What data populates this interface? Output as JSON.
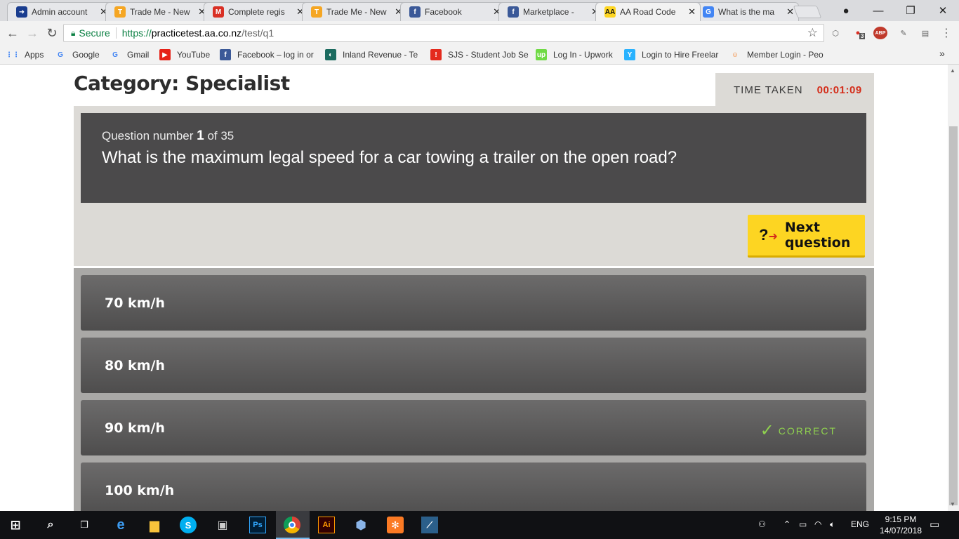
{
  "browser": {
    "tabs": [
      {
        "title": "Admin account",
        "icon": "arrow-circle-icon",
        "color": "#1a3d8f"
      },
      {
        "title": "Trade Me - New",
        "icon": "trademe-icon",
        "color": "#f5a623"
      },
      {
        "title": "Complete regis",
        "icon": "gmail-icon",
        "color": "#d93025"
      },
      {
        "title": "Trade Me - New",
        "icon": "trademe-icon",
        "color": "#f5a623"
      },
      {
        "title": "Facebook",
        "icon": "facebook-icon",
        "color": "#3b5998"
      },
      {
        "title": "Marketplace - ",
        "icon": "facebook-icon",
        "color": "#3b5998"
      },
      {
        "title": "AA Road Code",
        "icon": "aa-icon",
        "color": "#fdd522",
        "active": true
      },
      {
        "title": "What is the ma",
        "icon": "google-icon",
        "color": "#4285f4"
      }
    ],
    "close_glyph": "✕",
    "secure_label": "Secure",
    "url": {
      "proto": "https://",
      "host": "practicetest.aa.co.nz",
      "path": "/test/q1"
    },
    "extension_badge": "3",
    "abp_label": "ABP",
    "bookmarks": [
      {
        "label": "Apps",
        "icon": "apps-grid-icon",
        "color": "#4285f4"
      },
      {
        "label": "Google",
        "icon": "google-icon",
        "color": "#4285f4"
      },
      {
        "label": "Gmail",
        "icon": "google-icon",
        "color": "#4285f4"
      },
      {
        "label": "YouTube",
        "icon": "youtube-icon",
        "color": "#e62117"
      },
      {
        "label": "Facebook – log in or",
        "icon": "facebook-icon",
        "color": "#3b5998"
      },
      {
        "label": "Inland Revenue - Te",
        "icon": "inland-revenue-icon",
        "color": "#1b6b5f"
      },
      {
        "label": "SJS - Student Job Se",
        "icon": "sjs-icon",
        "color": "#e42a1d"
      },
      {
        "label": "Log In - Upwork",
        "icon": "upwork-icon",
        "color": "#6fda44"
      },
      {
        "label": "Login to Hire Freelar",
        "icon": "freelancer-icon",
        "color": "#29b2fe"
      },
      {
        "label": "Member Login - Peo",
        "icon": "smiley-icon",
        "color": "#f47b20"
      }
    ],
    "bookmarks_more": "»"
  },
  "page": {
    "category": "Category: Specialist",
    "time_taken_label": "TIME TAKEN",
    "time_taken_value": "00:01:09",
    "question_number_prefix": "Question number",
    "question_number": "1",
    "question_total": "of 35",
    "question_text": "What is the maximum legal speed for a car towing a trailer on the open road?",
    "next_button_label": "Next question",
    "next_icon_text": "?",
    "answers": [
      {
        "text": "70 km/h"
      },
      {
        "text": "80 km/h"
      },
      {
        "text": "90 km/h",
        "correct": true
      },
      {
        "text": "100 km/h"
      }
    ],
    "correct_label": "CORRECT",
    "colors": {
      "accent_yellow": "#fdd522",
      "timer_red": "#d42d1a",
      "correct_green": "#8fd14f",
      "question_bg": "#4b4a4b"
    }
  },
  "taskbar": {
    "apps": [
      "start-icon",
      "search-icon",
      "task-view-icon",
      "edge-icon",
      "file-explorer-icon",
      "skype-icon",
      "store-icon",
      "photoshop-icon",
      "chrome-icon",
      "illustrator-icon",
      "virtualbox-icon",
      "xampp-icon",
      "mysql-workbench-icon"
    ],
    "photoshop_label": "Ps",
    "illustrator_label": "Ai",
    "language": "ENG",
    "time": "9:15 PM",
    "date": "14/07/2018"
  }
}
